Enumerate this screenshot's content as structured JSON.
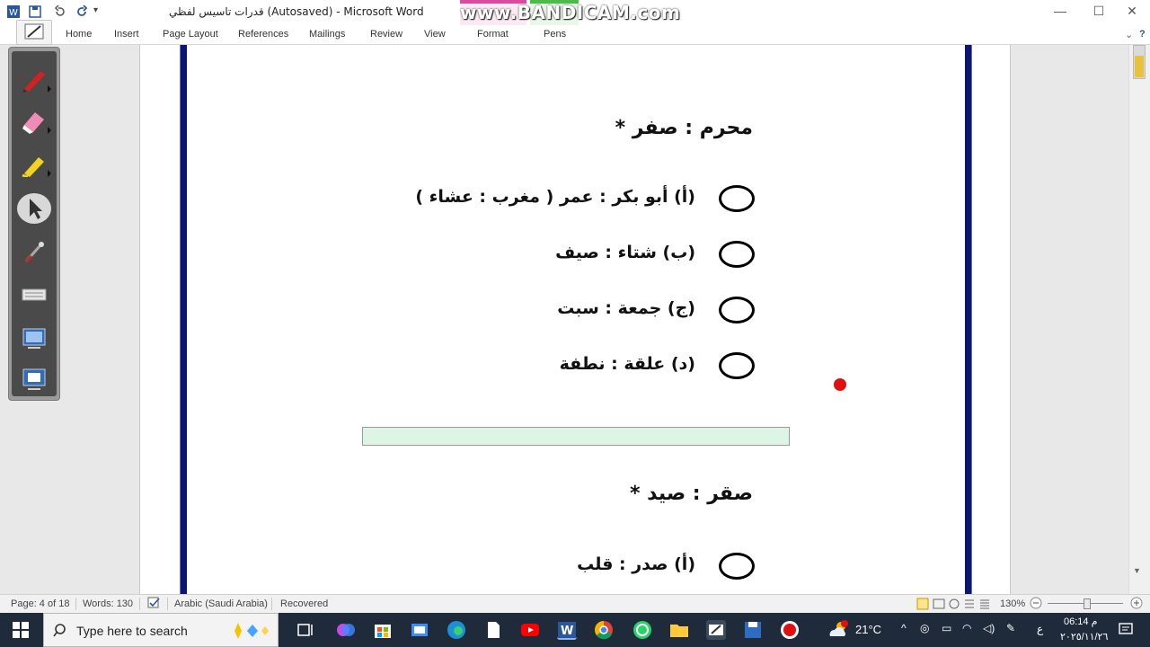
{
  "window": {
    "title": "قدرات تاسيس لفظي (Autosaved)  -  Microsoft Word",
    "watermark": "www.BANDICAM.com",
    "controls": {
      "minimize": "—",
      "maximize": "☐",
      "close": "✕"
    }
  },
  "ribbon": {
    "tabs": [
      "Home",
      "Insert",
      "Page Layout",
      "References",
      "Mailings",
      "Review",
      "View",
      "Format",
      "Pens"
    ]
  },
  "document": {
    "question1": {
      "title": "محرم : صفر *",
      "options": [
        "(أ) أبو بكر : عمر ( مغرب : عشاء )",
        "(ب) شتاء : صيف",
        "(ج) جمعة : سبت",
        "(د) علقة : نطفة"
      ]
    },
    "question2": {
      "title": "صقر : صيد *",
      "options": [
        "(أ) صدر : قلب"
      ]
    }
  },
  "statusbar": {
    "page": "Page: 4 of 18",
    "words": "Words: 130",
    "language": "Arabic (Saudi Arabia)",
    "recovered": "Recovered",
    "zoom": "130%"
  },
  "taskbar": {
    "search_placeholder": "Type here to search",
    "temperature": "21°C",
    "ime": "ع",
    "time": "06:14 م",
    "date": "٢٠٢٥/١١/٢٦"
  },
  "colors": {
    "page_border": "#0b1673",
    "divider_fill": "#ddf5e5",
    "format_tab": "#d94b9f",
    "pens_tab": "#4cbb4c",
    "taskbar": "#1f2b3a"
  }
}
